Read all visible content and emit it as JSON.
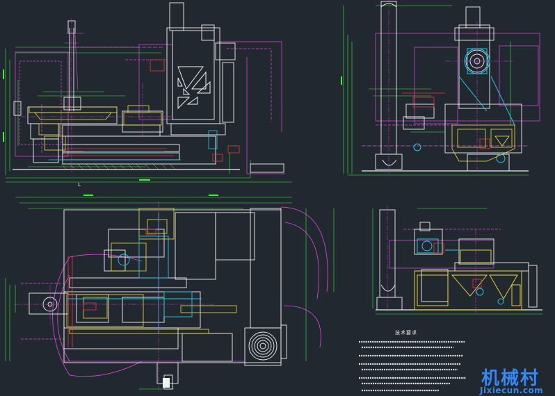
{
  "drawing": {
    "background": "#212830",
    "colors": {
      "outline": "#c9c9c9",
      "part": "#f2f2f2",
      "dimension": "#3cf03c",
      "center_line": "#d43cd4",
      "hidden": "#e24ae2",
      "hatch": "#f2e23a",
      "cyan": "#28c8e8",
      "red": "#e83a3a",
      "blue": "#3a6ae8"
    }
  },
  "scale_mark": "L",
  "notes": {
    "title": "技术要求"
  },
  "watermark": {
    "name": "机械村",
    "url": "Jixiecun.com"
  }
}
